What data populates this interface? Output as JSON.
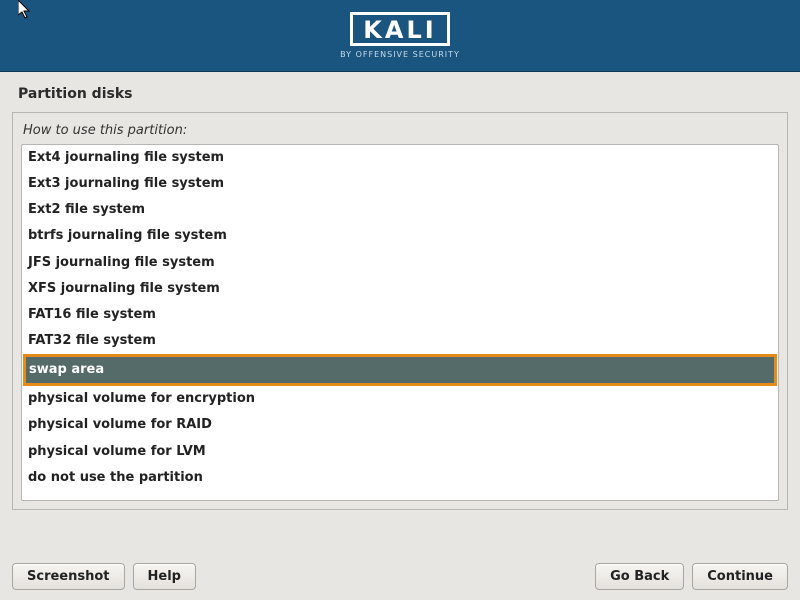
{
  "header": {
    "brand": "KALI",
    "tagline": "BY OFFENSIVE SECURITY"
  },
  "page_title": "Partition disks",
  "prompt": "How to use this partition:",
  "options": [
    {
      "label": "Ext4 journaling file system",
      "selected": false
    },
    {
      "label": "Ext3 journaling file system",
      "selected": false
    },
    {
      "label": "Ext2 file system",
      "selected": false
    },
    {
      "label": "btrfs journaling file system",
      "selected": false
    },
    {
      "label": "JFS journaling file system",
      "selected": false
    },
    {
      "label": "XFS journaling file system",
      "selected": false
    },
    {
      "label": "FAT16 file system",
      "selected": false
    },
    {
      "label": "FAT32 file system",
      "selected": false
    },
    {
      "label": "swap area",
      "selected": true
    },
    {
      "label": "physical volume for encryption",
      "selected": false
    },
    {
      "label": "physical volume for RAID",
      "selected": false
    },
    {
      "label": "physical volume for LVM",
      "selected": false
    },
    {
      "label": "do not use the partition",
      "selected": false
    }
  ],
  "buttons": {
    "screenshot": "Screenshot",
    "help": "Help",
    "go_back": "Go Back",
    "continue": "Continue"
  }
}
